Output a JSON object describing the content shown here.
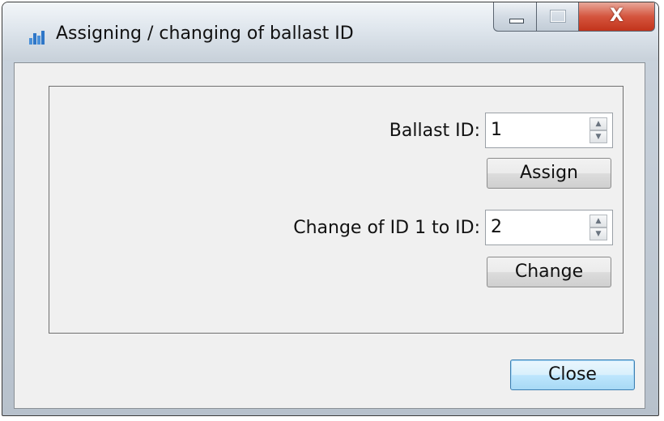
{
  "window": {
    "title": "Assigning / changing of ballast ID",
    "icon": "bar-chart-icon",
    "close_glyph": "X"
  },
  "form": {
    "ballast_id_label": "Ballast ID:",
    "ballast_id_value": "1",
    "assign_label": "Assign",
    "change_label": "Change of ID 1 to ID:",
    "change_value": "2",
    "change_button": "Change"
  },
  "footer": {
    "close_label": "Close"
  },
  "colors": {
    "close_button": "#c2331b",
    "default_button_border": "#3c7fb1",
    "dialog_background": "#f0f0f0"
  }
}
